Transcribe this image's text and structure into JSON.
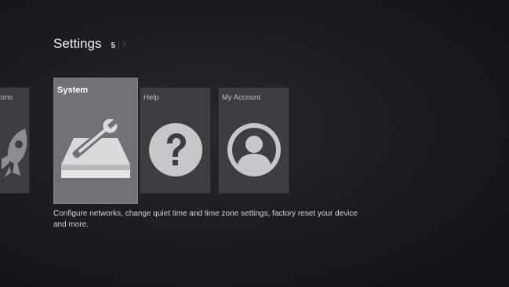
{
  "header": {
    "title": "Settings",
    "current_index": "5",
    "separator": "|",
    "total": "7"
  },
  "cards": [
    {
      "label": "cations",
      "icon": "rocket-icon"
    },
    {
      "label": "System",
      "icon": "drive-wrench-icon"
    },
    {
      "label": "Help",
      "icon": "question-icon"
    },
    {
      "label": "My Account",
      "icon": "user-icon"
    }
  ],
  "description": "Configure networks, change quiet time and time zone settings, factory reset your device and more.",
  "colors": {
    "background": "#1a1d21",
    "card": "#3b3e42",
    "selected_card": "#6f7377",
    "icon_fill": "#c6c7c8"
  }
}
